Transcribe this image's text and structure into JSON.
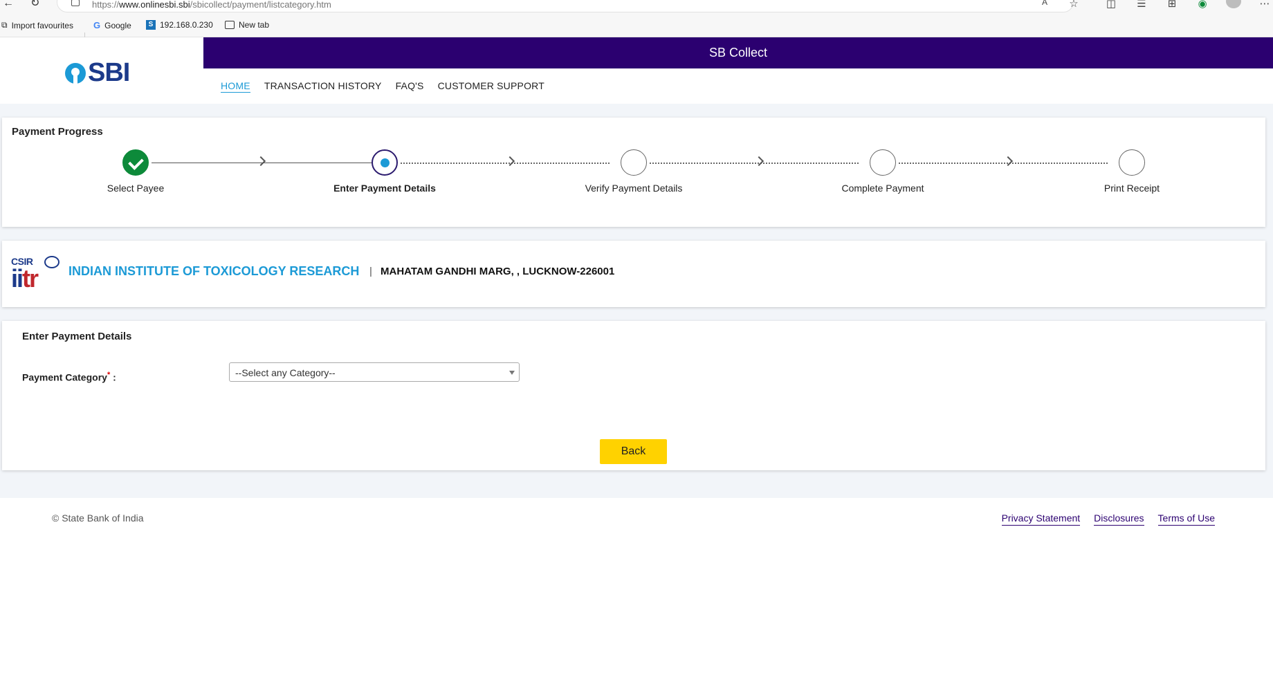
{
  "browser": {
    "url_prefix": "https://",
    "url_domain": "www.onlinesbi.sbi",
    "url_path": "/sbicollect/payment/listcategory.htm",
    "read_aloud_label": "Aˆ",
    "bookmarks": [
      {
        "label": "Import favourites",
        "icon": "import-icon"
      },
      {
        "label": "Google",
        "icon": "google-icon"
      },
      {
        "label": "192.168.0.230",
        "icon": "s-icon"
      },
      {
        "label": "New tab",
        "icon": "tab-icon"
      }
    ]
  },
  "header": {
    "logo_text": "SBI",
    "banner_title": "SB Collect",
    "nav": [
      "HOME",
      "TRANSACTION HISTORY",
      "FAQ'S",
      "CUSTOMER SUPPORT"
    ],
    "active_nav": "HOME"
  },
  "progress": {
    "title": "Payment Progress",
    "steps": [
      {
        "label": "Select Payee",
        "state": "done"
      },
      {
        "label": "Enter Payment Details",
        "state": "current"
      },
      {
        "label": "Verify Payment Details",
        "state": "pending"
      },
      {
        "label": "Complete Payment",
        "state": "pending"
      },
      {
        "label": "Print Receipt",
        "state": "pending"
      }
    ]
  },
  "institute": {
    "logo_top": "CSIR",
    "logo_main_a": "ii",
    "logo_main_b": "tr",
    "name": "INDIAN INSTITUTE OF TOXICOLOGY RESEARCH",
    "separator": "|",
    "address": "MAHATAM GANDHI MARG, , LUCKNOW-226001"
  },
  "payment_details": {
    "title": "Enter Payment Details",
    "category_label": "Payment Category",
    "required_mark": "*",
    "label_suffix": " :",
    "category_selected": "--Select any Category--",
    "back_label": "Back"
  },
  "footer": {
    "copyright": "© State Bank of India",
    "links": [
      "Privacy Statement",
      "Disclosures",
      "Terms of Use"
    ]
  },
  "colors": {
    "brand_purple": "#2b0070",
    "brand_blue": "#1c9ad6",
    "success_green": "#0d8a3a",
    "button_yellow": "#ffd200"
  }
}
